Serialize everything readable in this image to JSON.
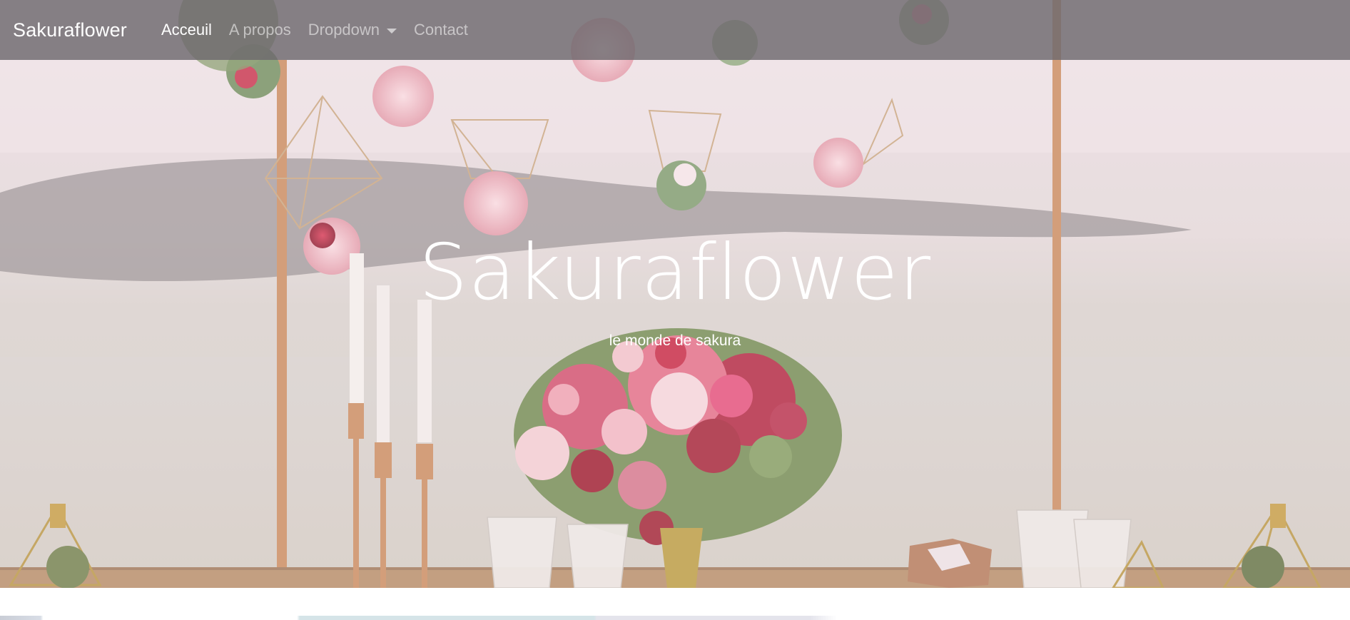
{
  "navbar": {
    "brand": "Sakuraflower",
    "links": [
      {
        "label": "Acceuil",
        "active": true
      },
      {
        "label": "A propos",
        "active": false
      },
      {
        "label": "Dropdown",
        "active": false,
        "has_caret": true
      },
      {
        "label": "Contact",
        "active": false
      }
    ]
  },
  "hero": {
    "title": "Sakuraflower",
    "subtitle": "le monde de sakura"
  },
  "colors": {
    "navbar_bg": "#6e696e",
    "text_white": "#ffffff",
    "copper": "#c98a5a",
    "rose": "#d9587a",
    "deep_red": "#9e1b2e"
  }
}
